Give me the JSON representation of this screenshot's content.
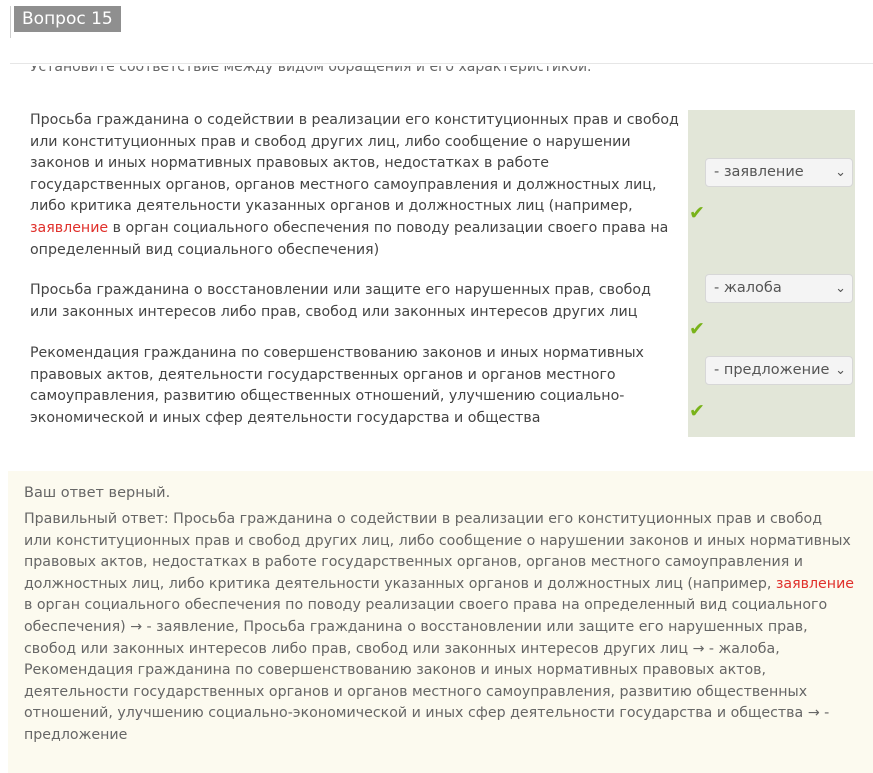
{
  "question": {
    "badge": "Вопрос 15",
    "prompt": "Установите соответствие между видом обращения и его характеристикой."
  },
  "rows": [
    {
      "text_before": "Просьба гражданина о содействии в реализации его конституционных прав и свобод или конституционных прав и свобод других лиц, либо сообщение о нарушении законов и иных нормативных правовых актов, недостатках в работе государственных органов, органов местного самоуправления и должностных лиц, либо критика деятельности указанных органов и должностных лиц (например, ",
      "highlight": "заявление",
      "text_after": " в орган социального обеспечения по поводу реализации своего права на определенный вид социального обеспечения)",
      "selected": "- заявление",
      "status": "correct"
    },
    {
      "text": "Просьба гражданина о восстановлении или защите его нарушенных прав, свобод или законных интересов либо прав, свобод или законных интересов других лиц",
      "selected": "- жалоба",
      "status": "correct"
    },
    {
      "text": "Рекомендация гражданина по совершенствованию законов и иных нормативных правовых актов, деятельности государственных органов и органов местного самоуправления, развитию общественных отношений, улучшению социально-экономической и иных сфер деятельности государства и общества",
      "selected": "- предложение",
      "status": "correct"
    }
  ],
  "feedback": {
    "verdict": "Ваш ответ верный.",
    "right_before": "Правильный ответ: Просьба гражданина о содействии в реализации его конституционных прав и свобод или конституционных прав и свобод других лиц, либо сообщение о нарушении законов и иных нормативных правовых актов, недостатках в работе государственных органов, органов местного самоуправления и должностных лиц, либо критика деятельности указанных органов и должностных лиц (например, ",
    "right_highlight": "заявление",
    "right_after": " в орган социального обеспечения по поводу реализации своего права на определенный вид социального обеспечения) → - заявление, Просьба гражданина о восстановлении или защите его нарушенных прав, свобод или законных интересов либо прав, свобод или законных интересов других лиц → - жалоба, Рекомендация гражданина по совершенствованию законов и иных нормативных правовых актов, деятельности государственных органов и органов местного самоуправления, развитию общественных отношений, улучшению социально-экономической и иных сфер деятельности государства и общества → - предложение"
  },
  "icons": {
    "check": "check-icon",
    "chevron": "chevron-down-icon"
  },
  "colors": {
    "highlight": "#e0302b",
    "check": "#79b31a",
    "answer_bg": "#e2e6d8",
    "feedback_bg": "#fcfaef"
  }
}
